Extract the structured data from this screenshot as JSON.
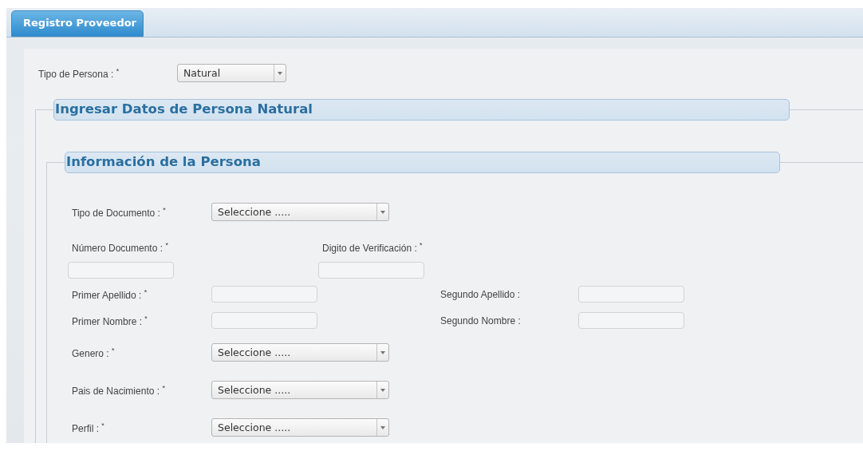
{
  "tabs": [
    {
      "label": "Registro Proveedor",
      "selected": true
    }
  ],
  "persona_type": {
    "label": "Tipo de Persona : $^{*}$",
    "value": "Natural"
  },
  "section": {
    "title": "Ingresar Datos de Persona Natural",
    "subsection": {
      "title": "Información de la Persona",
      "rows": [
        {
          "kind": "select",
          "fields": [
            {
              "label": "Tipo de Documento : $^{*}$",
              "kind": "select",
              "value": "Seleccione ....."
            }
          ]
        },
        {
          "kind": "stacked",
          "fields": [
            {
              "label": "Número Documento : $^{*}$",
              "kind": "text"
            },
            {
              "label": "Digito de Verificación : $^{*}$",
              "kind": "text"
            }
          ]
        },
        {
          "kind": "text",
          "fields": [
            {
              "label": "Primer Apellido : $^{*}$",
              "kind": "text"
            },
            {
              "label": "Segundo Apellido :",
              "kind": "text"
            }
          ]
        },
        {
          "kind": "text",
          "fields": [
            {
              "label": "Primer Nombre : $^{*}$",
              "kind": "text"
            },
            {
              "label": "Segundo Nombre :",
              "kind": "text"
            }
          ]
        },
        {
          "kind": "select",
          "fields": [
            {
              "label": "Genero : $^{*}$",
              "kind": "select",
              "value": "Seleccione ....."
            }
          ]
        },
        {
          "kind": "select",
          "fields": [
            {
              "label": "Pais de Nacimiento : $^{*}$",
              "kind": "select",
              "value": "Seleccione ....."
            }
          ]
        },
        {
          "kind": "select",
          "fields": [
            {
              "label": "Perfil : $^{*}$",
              "kind": "select",
              "value": "Seleccione ....."
            }
          ]
        }
      ]
    }
  }
}
